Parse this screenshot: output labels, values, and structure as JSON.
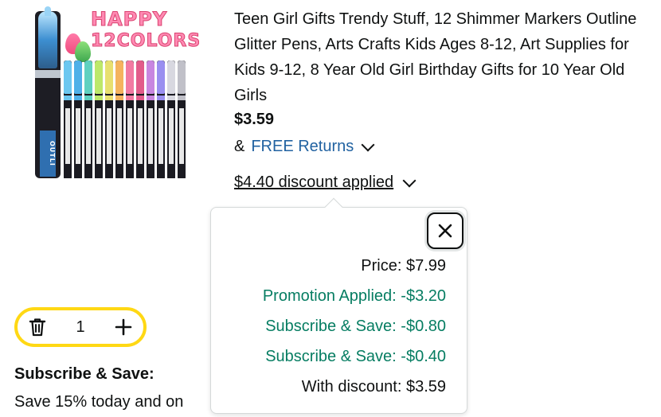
{
  "product": {
    "image_alt": "12 shimmer outline markers",
    "image_headline_1": "HAPPY",
    "image_headline_2": "12COLORS",
    "big_marker_label": "OUTLI",
    "title": "Teen Girl Gifts Trendy Stuff, 12 Shimmer Markers Outline Glitter Pens, Arts Crafts Kids Ages 8-12, Art Supplies for Kids 9-12, 8 Year Old Girl Birthday Gifts for 10 Year Old Girls",
    "price": "$3.59",
    "returns_prefix": "&",
    "returns_link": "FREE Returns",
    "discount_link": "$4.40 discount applied"
  },
  "popover": {
    "close_label": "Close",
    "lines": [
      {
        "label": "Price: $7.99",
        "color": "#0f1111"
      },
      {
        "label": "Promotion Applied: -$3.20",
        "color": "#067d62"
      },
      {
        "label": "Subscribe & Save: -$0.80",
        "color": "#067d62"
      },
      {
        "label": "Subscribe & Save: -$0.40",
        "color": "#067d62"
      },
      {
        "label": "With discount: $3.59",
        "color": "#0f1111"
      }
    ]
  },
  "quantity": {
    "value": "1",
    "decrement_icon": "trash-icon",
    "increment_icon": "plus-icon"
  },
  "subscribe": {
    "title": "Subscribe & Save:",
    "description": "Save 15% today and on"
  },
  "colors": {
    "link": "#2162a1",
    "green": "#067d62",
    "stepper_border": "#ffd814"
  }
}
